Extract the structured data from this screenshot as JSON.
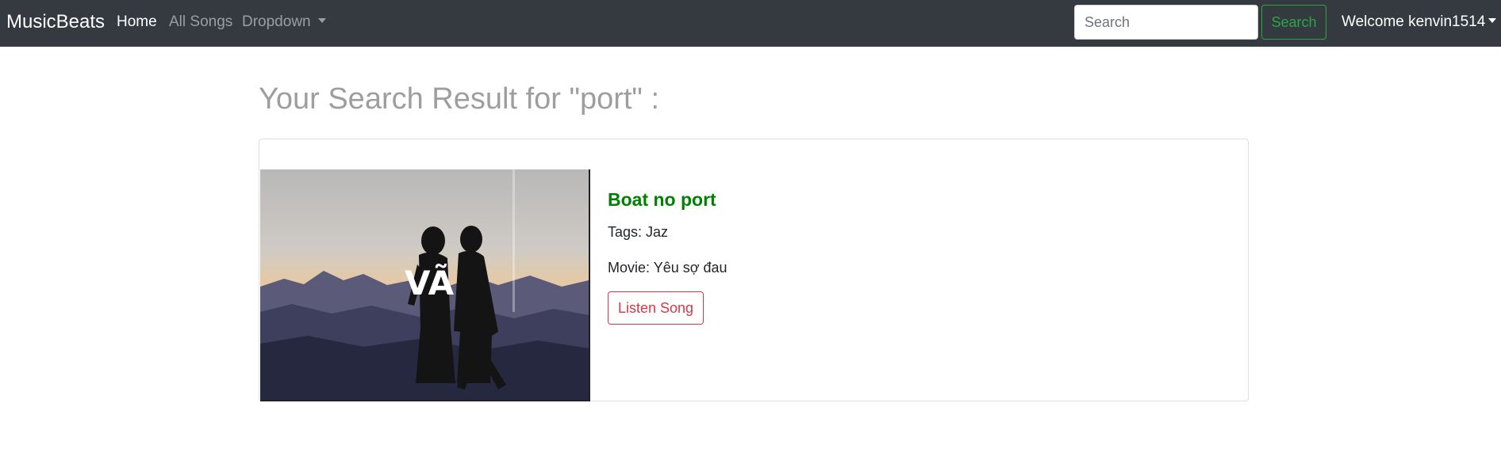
{
  "navbar": {
    "brand": "MusicBeats",
    "links": [
      {
        "label": "Home",
        "active": true
      },
      {
        "label": "All Songs",
        "active": false
      },
      {
        "label": "Dropdown",
        "active": false
      }
    ],
    "search": {
      "placeholder": "Search",
      "value": "",
      "button_label": "Search"
    },
    "user_menu_label": "Welcome kenvin1514"
  },
  "main": {
    "heading": "Your Search Result for \"port\" :",
    "results": [
      {
        "title": "Boat no port",
        "tags_label": "Tags: Jaz",
        "movie_label": "Movie: Yêu sợ đau",
        "button_label": "Listen Song",
        "cover_watermark": "VÃ"
      }
    ]
  },
  "colors": {
    "navbar_bg": "#343a40",
    "success": "#28a745",
    "danger": "#dc3545",
    "song_title": "#008000",
    "heading": "#9e9e9e"
  },
  "icons": {
    "dropdown_caret": "chevron-down-icon"
  }
}
